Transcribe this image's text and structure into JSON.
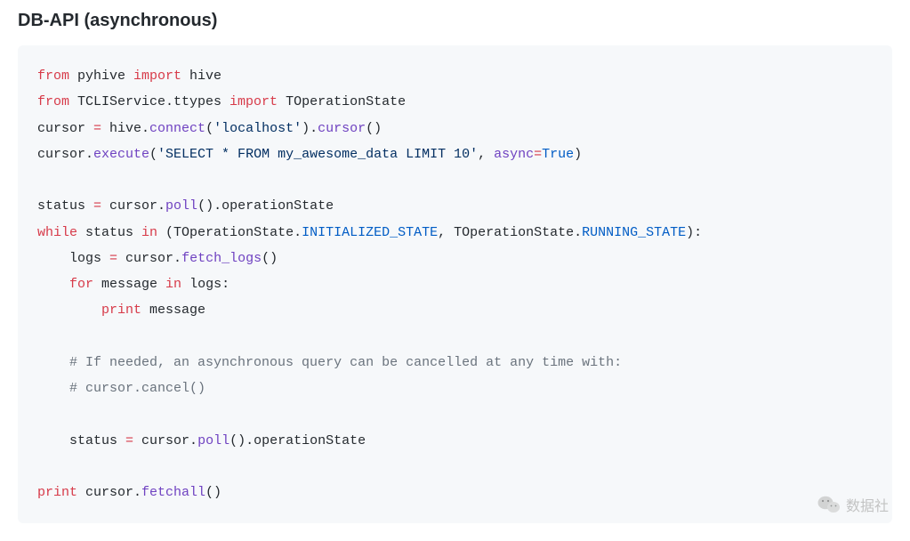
{
  "heading": "DB-API (asynchronous)",
  "watermark": "数据社",
  "code": {
    "l1_kw1": "from",
    "l1_mod": " pyhive ",
    "l1_kw2": "import",
    "l1_tail": " hive",
    "l2_kw1": "from",
    "l2_mod": " TCLIService.ttypes ",
    "l2_kw2": "import",
    "l2_tail": " TOperationState",
    "l3_pre": "cursor ",
    "l3_eq": "=",
    "l3_mid1": " hive.",
    "l3_fn1": "connect",
    "l3_p1": "(",
    "l3_str1": "'localhost'",
    "l3_p2": ").",
    "l3_fn2": "cursor",
    "l3_p3": "()",
    "l4_pre": "cursor.",
    "l4_fn": "execute",
    "l4_p1": "(",
    "l4_str": "'SELECT * FROM my_awesome_data LIMIT 10'",
    "l4_mid": ", ",
    "l4_kw_async": "async",
    "l4_eq": "=",
    "l4_true": "True",
    "l4_p2": ")",
    "l6_pre": "status ",
    "l6_eq": "=",
    "l6_mid": " cursor.",
    "l6_fn": "poll",
    "l6_p": "().operationState",
    "l7_kw1": "while",
    "l7_a": " status ",
    "l7_kw2": "in",
    "l7_b": " (TOperationState.",
    "l7_c1": "INITIALIZED_STATE",
    "l7_c": ", TOperationState.",
    "l7_c2": "RUNNING_STATE",
    "l7_d": "):",
    "l8_ind": "    ",
    "l8_pre": "logs ",
    "l8_eq": "=",
    "l8_mid": " cursor.",
    "l8_fn": "fetch_logs",
    "l8_p": "()",
    "l9_ind": "    ",
    "l9_kw1": "for",
    "l9_a": " message ",
    "l9_kw2": "in",
    "l9_b": " logs:",
    "l10_ind": "        ",
    "l10_kw": "print",
    "l10_a": " message",
    "l12_ind": "    ",
    "l12_cmt": "# If needed, an asynchronous query can be cancelled at any time with:",
    "l13_ind": "    ",
    "l13_cmt": "# cursor.cancel()",
    "l15_ind": "    ",
    "l15_pre": "status ",
    "l15_eq": "=",
    "l15_mid": " cursor.",
    "l15_fn": "poll",
    "l15_p": "().operationState",
    "l17_kw": "print",
    "l17_a": " cursor.",
    "l17_fn": "fetchall",
    "l17_p": "()"
  }
}
